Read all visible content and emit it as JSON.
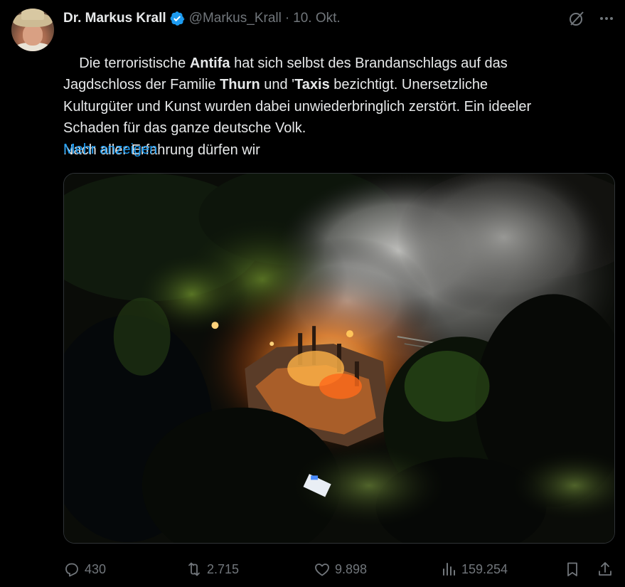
{
  "author": {
    "display_name": "Dr. Markus Krall",
    "handle": "@Markus_Krall",
    "separator": "·",
    "date": "10. Okt.",
    "avatar_icon": "user-avatar",
    "verified_icon": "verified-badge-icon",
    "verified_color": "#1d9bf0"
  },
  "top_icons": [
    "grok-icon",
    "more-icon"
  ],
  "tweet": {
    "segments": [
      {
        "text": "Die terroristische ",
        "bold": false
      },
      {
        "text": "Antifa",
        "bold": true
      },
      {
        "text": " hat sich selbst des Brandanschlags auf das\nJagdschloss der Familie ",
        "bold": false
      },
      {
        "text": "Thurn",
        "bold": true
      },
      {
        "text": " und '",
        "bold": false
      },
      {
        "text": "Taxis",
        "bold": true
      },
      {
        "text": " bezichtigt. Unersetzliche\nKulturgüter und Kunst wurden dabei unwiederbringlich zerstört. Ein ideeler\nSchaden für das ganze deutsche Volk.\nNach aller Erfahrung dürfen wir",
        "bold": false
      }
    ],
    "show_more_label": "Mehr anzeigen",
    "link_color": "#1d9bf0"
  },
  "media": {
    "kind": "photo",
    "subject": "aerial night photo of burning building among trees"
  },
  "actions": {
    "reply": {
      "icon": "reply-icon",
      "count": "430"
    },
    "retweet": {
      "icon": "retweet-icon",
      "count": "2.715"
    },
    "like": {
      "icon": "heart-icon",
      "count": "9.898"
    },
    "views": {
      "icon": "views-icon",
      "count": "159.254"
    },
    "bookmark": {
      "icon": "bookmark-icon"
    },
    "share": {
      "icon": "share-icon"
    }
  },
  "colors": {
    "background": "#000000",
    "text": "#e7e9ea",
    "secondary": "#71767b"
  }
}
